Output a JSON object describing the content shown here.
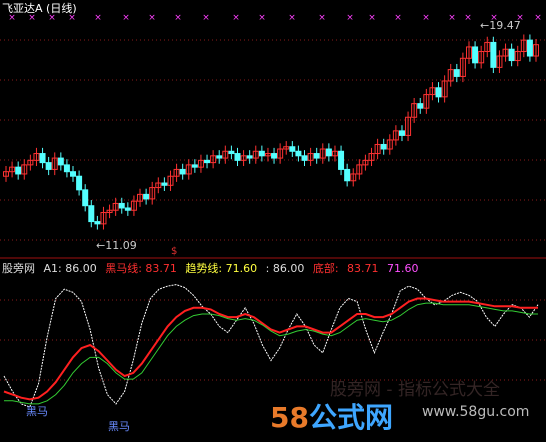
{
  "title": "飞亚达A (日线)",
  "price_high_label": "19.47",
  "price_low_label": "11.09",
  "signal_label": "$",
  "indicator_bar": {
    "name": "股旁网",
    "a1": "A1: 86.00",
    "heima": "黑马线: 83.71",
    "trend": "趋势线: 71.60",
    "v": ": 86.00",
    "bottom_label": "底部:",
    "bottom_v1": "83.71",
    "bottom_v2": "71.60"
  },
  "heima_marks": [
    "黑马",
    "黑马"
  ],
  "watermark": {
    "text1": "股旁网 - 指标公式大全",
    "num": "58",
    "word": "公式网",
    "url": "www.58gu.com"
  },
  "colors": {
    "up": "#ff3232",
    "down": "#54ffff",
    "grid": "#8b1a1a",
    "white_line": "#ffffff",
    "red_line": "#ff2020",
    "green_line": "#33cc33",
    "purple_mark": "#ff40ff"
  },
  "chart_data": [
    {
      "type": "candlestick",
      "title": "飞亚达A (日线)",
      "annotations": {
        "high": 19.47,
        "low": 11.09
      },
      "ylim": [
        10.5,
        20.2
      ],
      "close": [
        13.6,
        13.8,
        13.5,
        13.9,
        14.1,
        14.4,
        14.0,
        13.7,
        14.2,
        13.9,
        13.6,
        13.4,
        12.8,
        12.1,
        11.4,
        11.3,
        11.8,
        11.9,
        12.2,
        12.0,
        11.9,
        12.3,
        12.6,
        12.4,
        12.9,
        13.1,
        13.0,
        13.4,
        13.7,
        13.5,
        13.9,
        13.8,
        14.1,
        14.0,
        14.3,
        14.2,
        14.5,
        14.4,
        14.1,
        14.3,
        14.2,
        14.5,
        14.3,
        14.4,
        14.2,
        14.6,
        14.7,
        14.5,
        14.3,
        14.1,
        14.4,
        14.2,
        14.6,
        14.3,
        14.5,
        13.7,
        13.2,
        13.5,
        13.9,
        14.1,
        14.4,
        14.8,
        14.6,
        15.0,
        15.4,
        15.2,
        16.0,
        16.6,
        16.4,
        17.0,
        17.3,
        16.9,
        17.6,
        18.1,
        17.8,
        18.6,
        19.1,
        18.4,
        18.9,
        19.3,
        18.2,
        18.7,
        19.0,
        18.5,
        18.9,
        19.4,
        18.7,
        19.2
      ],
      "open": [
        13.4,
        13.6,
        13.8,
        13.5,
        13.9,
        14.1,
        14.4,
        14.0,
        13.7,
        14.2,
        13.9,
        13.6,
        13.4,
        12.8,
        12.1,
        11.4,
        11.3,
        11.8,
        11.9,
        12.2,
        12.0,
        11.9,
        12.3,
        12.6,
        12.4,
        12.9,
        13.1,
        13.0,
        13.4,
        13.7,
        13.5,
        13.9,
        13.8,
        14.1,
        14.0,
        14.3,
        14.2,
        14.5,
        14.4,
        14.1,
        14.3,
        14.2,
        14.5,
        14.3,
        14.4,
        14.2,
        14.6,
        14.7,
        14.5,
        14.3,
        14.1,
        14.4,
        14.2,
        14.6,
        14.3,
        14.5,
        13.7,
        13.2,
        13.5,
        13.9,
        14.1,
        14.4,
        14.8,
        14.6,
        15.0,
        15.4,
        15.2,
        16.0,
        16.6,
        16.4,
        17.0,
        17.3,
        16.9,
        17.6,
        18.1,
        17.8,
        18.6,
        19.1,
        18.4,
        18.9,
        19.3,
        18.2,
        18.7,
        19.0,
        18.5,
        18.9,
        19.4,
        18.7
      ]
    },
    {
      "type": "line",
      "series": [
        {
          "name": "A1",
          "values": [
            40,
            30,
            22,
            20,
            35,
            65,
            90,
            96,
            94,
            88,
            70,
            45,
            28,
            22,
            30,
            50,
            74,
            90,
            96,
            98,
            99,
            97,
            92,
            85,
            80,
            72,
            68,
            76,
            84,
            74,
            60,
            50,
            58,
            70,
            80,
            72,
            60,
            55,
            70,
            84,
            90,
            88,
            70,
            55,
            68,
            80,
            95,
            98,
            96,
            90,
            86,
            88,
            92,
            94,
            92,
            88,
            78,
            72,
            80,
            86,
            84,
            78,
            86
          ]
        },
        {
          "name": "黑马线",
          "values": [
            30,
            28,
            26,
            25,
            26,
            30,
            36,
            44,
            52,
            58,
            60,
            56,
            50,
            44,
            40,
            42,
            48,
            56,
            64,
            72,
            78,
            82,
            84,
            84,
            83,
            80,
            78,
            78,
            80,
            78,
            74,
            70,
            68,
            70,
            72,
            72,
            70,
            68,
            68,
            72,
            76,
            80,
            80,
            78,
            78,
            80,
            84,
            88,
            90,
            90,
            89,
            88,
            88,
            88,
            88,
            87,
            86,
            85,
            85,
            85,
            84,
            84,
            84
          ]
        },
        {
          "name": "趋势线",
          "values": [
            24,
            24,
            23,
            22,
            22,
            24,
            28,
            34,
            42,
            48,
            52,
            52,
            48,
            42,
            38,
            38,
            42,
            50,
            58,
            66,
            72,
            76,
            79,
            80,
            80,
            79,
            77,
            76,
            77,
            76,
            73,
            69,
            66,
            67,
            69,
            70,
            69,
            67,
            66,
            68,
            72,
            76,
            77,
            76,
            75,
            76,
            79,
            83,
            86,
            87,
            87,
            86,
            86,
            86,
            86,
            85,
            84,
            83,
            82,
            82,
            81,
            80,
            80
          ]
        }
      ],
      "ylim": [
        0,
        100
      ]
    }
  ]
}
